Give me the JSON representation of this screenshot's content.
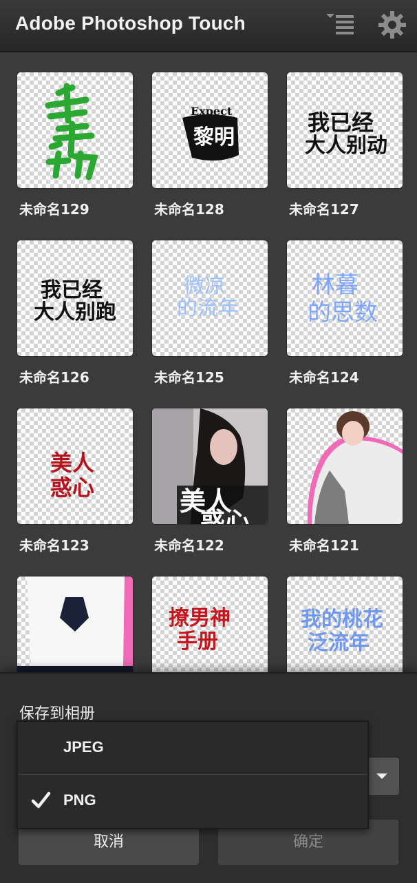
{
  "app": {
    "title": "Adobe Photoshop Touch"
  },
  "gallery": {
    "items": [
      {
        "label": "未命名129",
        "art": "千年劫"
      },
      {
        "label": "未命名128",
        "art": "Expect 黎明"
      },
      {
        "label": "未命名127",
        "art": "我已经大人别动"
      },
      {
        "label": "未命名126",
        "art": "我已经大人别跑"
      },
      {
        "label": "未命名125",
        "art": "微凉的流年"
      },
      {
        "label": "未命名124",
        "art": "林暮的思数"
      },
      {
        "label": "未命名123",
        "art": "美人惑心"
      },
      {
        "label": "未命名122",
        "art": "美人惑心"
      },
      {
        "label": "未命名121",
        "art": ""
      },
      {
        "label": "",
        "art": ""
      },
      {
        "label": "",
        "art": "撩男神手册"
      },
      {
        "label": "",
        "art": "我的桃花泛流年"
      }
    ]
  },
  "save_sheet": {
    "title": "保存到相册",
    "cancel_label": "取消",
    "confirm_label": "确定"
  },
  "format_menu": {
    "options": [
      {
        "label": "JPEG",
        "selected": false
      },
      {
        "label": "PNG",
        "selected": true
      }
    ]
  },
  "colors": {
    "accent_red": "#b5121b",
    "art_green": "#27a62e",
    "art_blue": "#8fb3ff",
    "pink_outline": "#f06ab8"
  }
}
